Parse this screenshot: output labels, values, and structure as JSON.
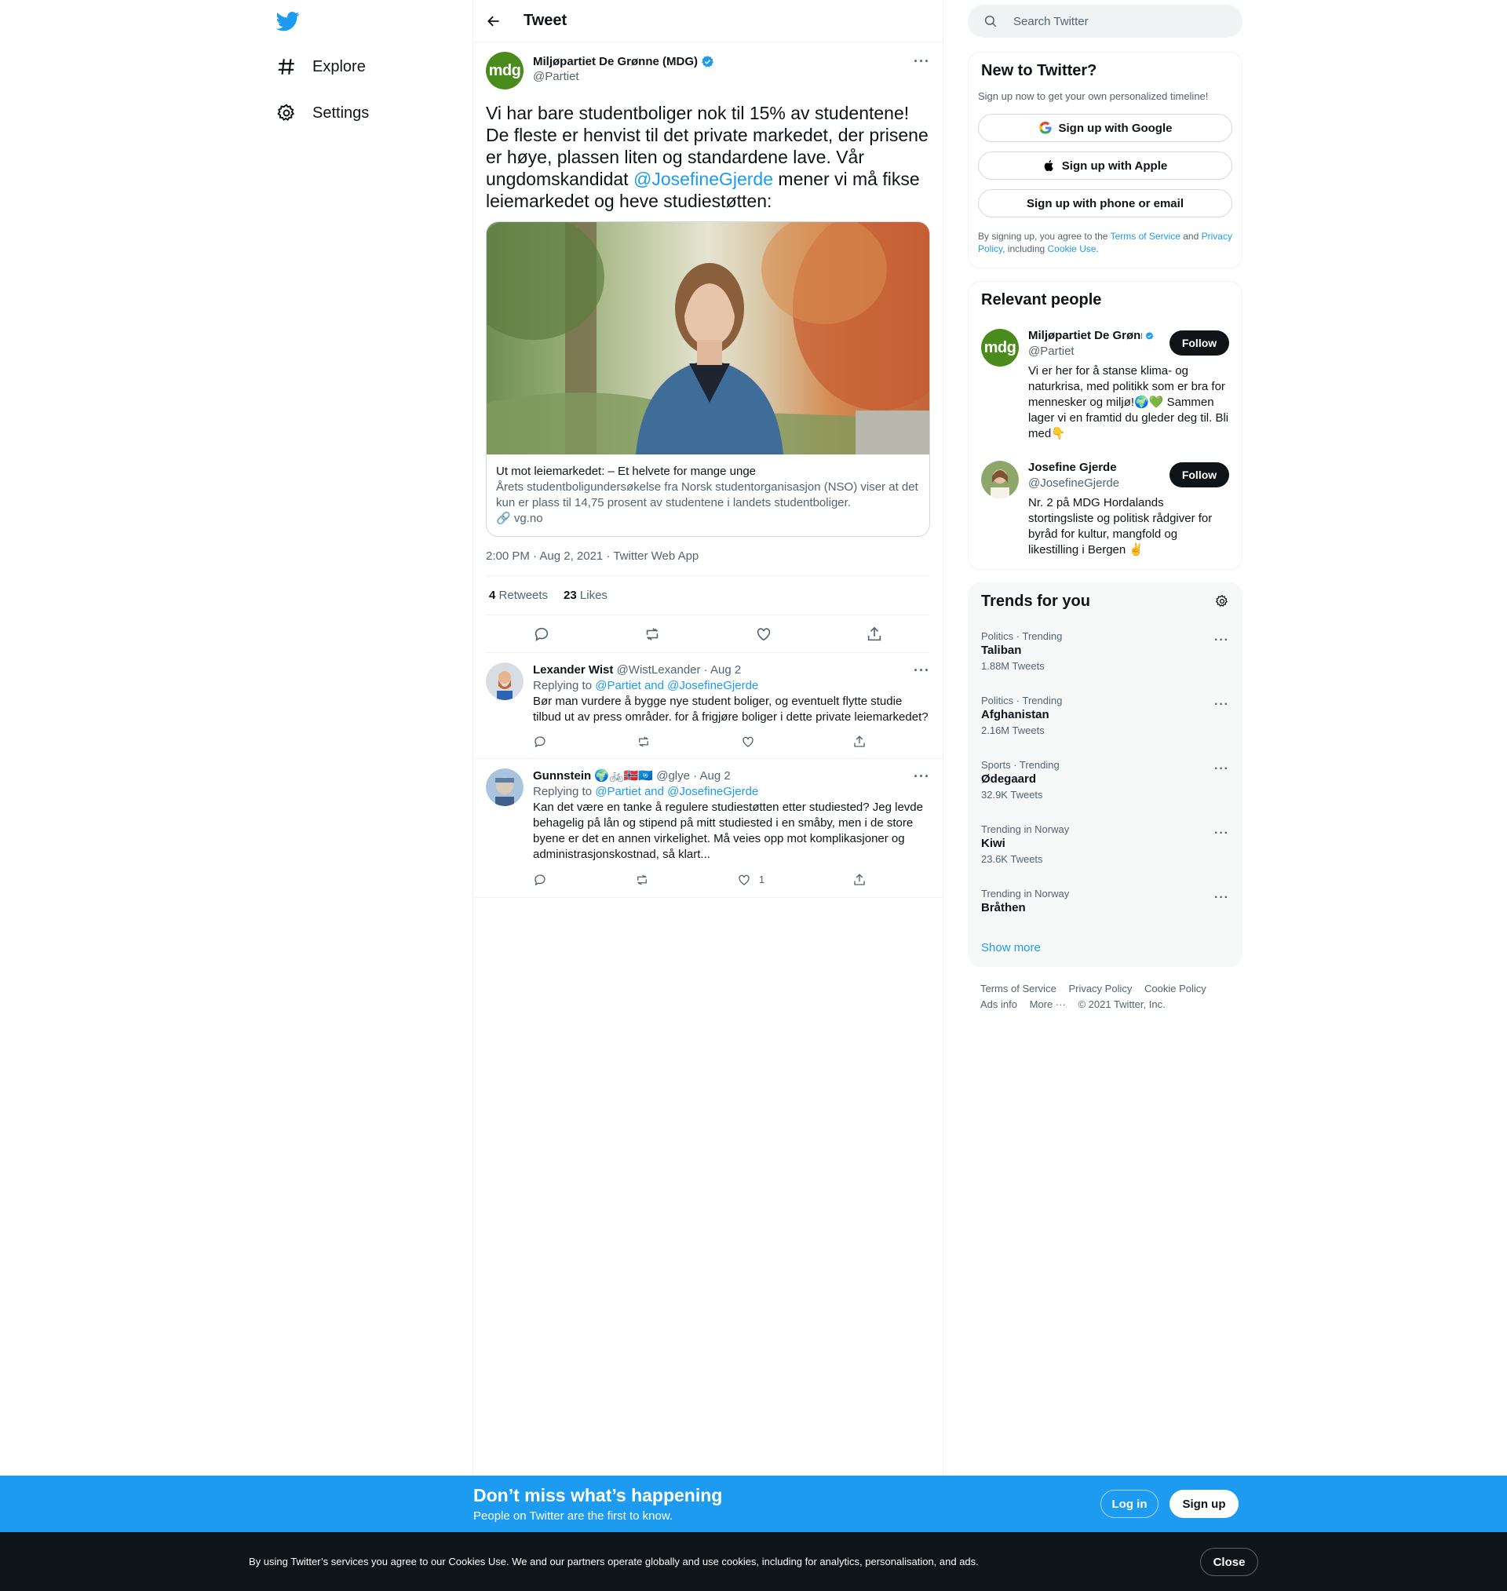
{
  "nav": {
    "logo_icon": "twitter-bird-icon",
    "items": [
      {
        "icon": "hashtag-icon",
        "label": "Explore"
      },
      {
        "icon": "gear-icon",
        "label": "Settings"
      }
    ]
  },
  "header": {
    "back_icon": "arrow-left-icon",
    "title": "Tweet"
  },
  "tweet": {
    "author_name": "Miljøpartiet De Grønne (MDG)",
    "author_handle": "@Partiet",
    "avatar_text": "mdg",
    "text_before": "Vi har bare studentboliger nok til 15% av studentene! De fleste er henvist til det private markedet, der prisene er høye, plassen liten og standardene lave. Vår ungdomskandidat ",
    "mention": "@JosefineGjerde",
    "text_after": " mener vi må fikse leiemarkedet og heve studiestøtten:",
    "card": {
      "title": "Ut mot leiemarkedet: – Et helvete for mange unge",
      "description": "Årets studentboligundersøkelse fra Norsk studentorganisasjon (NSO) viser at det kun er plass til 14,75 prosent av studentene i landets studentboliger.",
      "domain": "vg.no"
    },
    "timestamp": "2:00 PM · Aug 2, 2021 · Twitter Web App",
    "retweets_count": "4",
    "retweets_label": "Retweets",
    "likes_count": "23",
    "likes_label": "Likes"
  },
  "replies": [
    {
      "name": "Lexander Wist",
      "handle_date": "@WistLexander · Aug 2",
      "replying_label": "Replying to ",
      "replying_to": "@Partiet and @JosefineGjerde",
      "text": "Bør man vurdere å bygge nye student boliger, og eventuelt flytte studie tilbud ut av press områder. for å frigjøre boliger i dette private leiemarkedet?",
      "like_count": ""
    },
    {
      "name": "Gunnstein",
      "name_emoji": "🌍🚲🇳🇴🇺🇳",
      "handle_date": "@glye · Aug 2",
      "replying_label": "Replying to ",
      "replying_to": "@Partiet and @JosefineGjerde",
      "text": "Kan det være en tanke å regulere studiestøtten etter studiested? Jeg levde behagelig på lån og stipend på mitt studiested i en småby, men i de store byene er det en annen virkelighet. Må veies opp mot komplikasjoner og administrasjonskostnad, så klart...",
      "like_count": "1"
    }
  ],
  "search": {
    "placeholder": "Search Twitter"
  },
  "new_to_twitter": {
    "title": "New to Twitter?",
    "subtitle": "Sign up now to get your own personalized timeline!",
    "google": "Sign up with Google",
    "apple": "Sign up with Apple",
    "phone": "Sign up with phone or email",
    "legal_1": "By signing up, you agree to the ",
    "terms": "Terms of Service",
    "legal_2": " and ",
    "privacy": "Privacy Policy",
    "legal_3": ", including ",
    "cookie": "Cookie Use",
    "legal_4": "."
  },
  "relevant_people": {
    "title": "Relevant people",
    "people": [
      {
        "name": "Miljøpartiet De Grønne (MDG)",
        "handle": "@Partiet",
        "bio": "Vi er her for å stanse klima- og naturkrisa, med politikk som er bra for mennesker og miljø!🌍💚 Sammen lager vi en framtid du gleder deg til. Bli med👇",
        "follow": "Follow"
      },
      {
        "name": "Josefine Gjerde",
        "handle": "@JosefineGjerde",
        "bio": "Nr. 2 på MDG Hordalands stortingsliste og politisk rådgiver for byråd for kultur, mangfold og likestilling i Bergen ✌️",
        "follow": "Follow"
      }
    ]
  },
  "trends": {
    "title": "Trends for you",
    "items": [
      {
        "category": "Politics · Trending",
        "name": "Taliban",
        "count": "1.88M Tweets"
      },
      {
        "category": "Politics · Trending",
        "name": "Afghanistan",
        "count": "2.16M Tweets"
      },
      {
        "category": "Sports · Trending",
        "name": "Ødegaard",
        "count": "32.9K Tweets"
      },
      {
        "category": "Trending in Norway",
        "name": "Kiwi",
        "count": "23.6K Tweets"
      },
      {
        "category": "Trending in Norway",
        "name": "Bråthen",
        "count": ""
      }
    ],
    "show_more": "Show more"
  },
  "footer": {
    "terms": "Terms of Service",
    "privacy": "Privacy Policy",
    "cookie": "Cookie Policy",
    "ads": "Ads info",
    "more": "More ···",
    "copyright": "© 2021 Twitter, Inc."
  },
  "signup_bar": {
    "title": "Don’t miss what’s happening",
    "subtitle": "People on Twitter are the first to know.",
    "login": "Log in",
    "signup": "Sign up"
  },
  "cookie_bar": {
    "text": "By using Twitter’s services you agree to our Cookies Use. We and our partners operate globally and use cookies, including for analytics, personalisation, and ads.",
    "close": "Close"
  },
  "colors": {
    "accent": "#1d9bf0",
    "mdg_green": "#4a8c1c",
    "dark": "#0f1419"
  }
}
